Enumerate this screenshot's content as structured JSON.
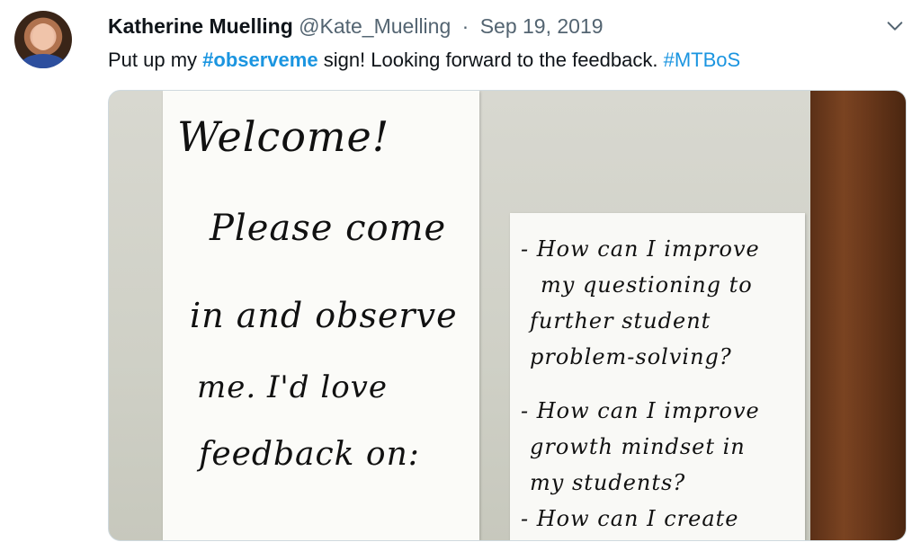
{
  "author": {
    "name": "Katherine Muelling",
    "handle": "@Kate_Muelling",
    "separator": "·",
    "date": "Sep 19, 2019"
  },
  "tweet": {
    "text_pre": "Put up my ",
    "hashtag1": "#observeme",
    "text_mid": " sign! Looking forward to the feedback. ",
    "hashtag2": "#MTBoS"
  },
  "photo": {
    "sign_left": [
      "Welcome!",
      "Please come",
      "in and observe",
      "me. I'd love",
      "feedback on:"
    ],
    "sign_right": [
      "- How can I improve",
      "my questioning to",
      "further student",
      "problem-solving?",
      "- How can I improve",
      "growth mindset in",
      "my students?",
      "- How can I create"
    ]
  },
  "icons": {
    "avatar": "avatar",
    "menu": "chevron-down-icon"
  },
  "colors": {
    "link": "#1b95e0",
    "text": "#0f1419",
    "secondary": "#536471"
  }
}
